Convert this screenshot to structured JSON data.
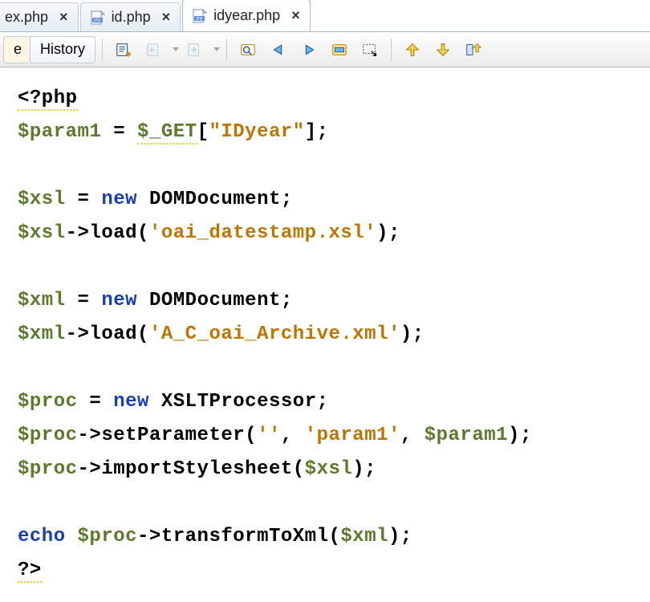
{
  "tabs": [
    {
      "label": "ex.php"
    },
    {
      "label": "id.php"
    },
    {
      "label": "idyear.php"
    }
  ],
  "toolbar": {
    "source_tab": "e",
    "history_tab": "History"
  },
  "code": {
    "open_tag": "<?php",
    "l1_var": "$param1",
    "l1_get": "$_GET",
    "l1_key": "\"IDyear\"",
    "l2_var": "$xsl",
    "kw_new": "new",
    "cls_domdoc": "DOMDocument",
    "m_load": "load",
    "str_xsl": "'oai_datestamp.xsl'",
    "l3_var": "$xml",
    "str_xml": "'A_C_oai_Archive.xml'",
    "l4_var": "$proc",
    "cls_xslt": "XSLTProcessor",
    "m_setparam": "setParameter",
    "str_empty": "''",
    "str_param1": "'param1'",
    "m_import": "importStylesheet",
    "kw_echo": "echo",
    "m_transform": "transformToXml",
    "close_tag": "?>"
  }
}
